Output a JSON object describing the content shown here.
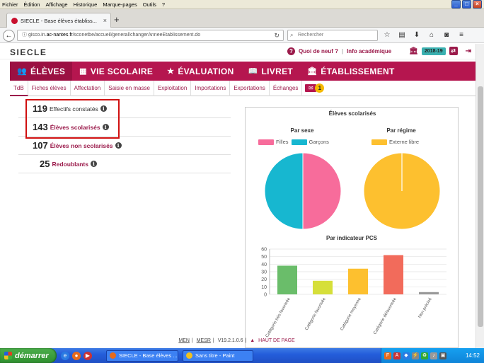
{
  "browser": {
    "menu": [
      "Fichier",
      "Édition",
      "Affichage",
      "Historique",
      "Marque-pages",
      "Outils",
      "?"
    ],
    "tab_title": "SIECLE - Base élèves établiss...",
    "url_prefix": "gisco.in.",
    "url_domain": "ac-nantes.fr",
    "url_path": "/sconetbe/accueil/general/changerAnneeEtablissement.do",
    "search_placeholder": "Rechercher"
  },
  "header": {
    "logo": "SIECLE",
    "whats_new": "Quoi de neuf ?",
    "academic_info": "Info académique",
    "year": "2018-19"
  },
  "main_nav": [
    {
      "label": "ÉLÈVES",
      "icon": "users-icon",
      "active": true
    },
    {
      "label": "VIE SCOLAIRE",
      "icon": "calendar-icon",
      "active": false
    },
    {
      "label": "ÉVALUATION",
      "icon": "star-icon",
      "active": false
    },
    {
      "label": "LIVRET",
      "icon": "book-icon",
      "active": false
    },
    {
      "label": "ÉTABLISSEMENT",
      "icon": "building-icon",
      "active": false
    }
  ],
  "sub_nav": [
    {
      "label": "TdB",
      "active": true
    },
    {
      "label": "Fiches élèves"
    },
    {
      "label": "Affectation"
    },
    {
      "label": "Saisie en masse"
    },
    {
      "label": "Exploitation"
    },
    {
      "label": "Importations"
    },
    {
      "label": "Exportations"
    },
    {
      "label": "Échanges"
    }
  ],
  "mail_count": "1",
  "stats": [
    {
      "value": "119",
      "label": "Effectifs constatés",
      "link": false
    },
    {
      "value": "143",
      "label": "Élèves scolarisés",
      "link": true
    },
    {
      "value": "107",
      "label": "Élèves non scolarisés",
      "link": true
    },
    {
      "value": "25",
      "label": "Redoublants",
      "link": true
    }
  ],
  "panel_title": "Élèves scolarisés",
  "chart_data": [
    {
      "type": "pie",
      "title": "Par sexe",
      "categories": [
        "Filles",
        "Garçons"
      ],
      "values": [
        50,
        50
      ],
      "colors": [
        "#f76c9b",
        "#17b7d0"
      ],
      "legend": "top"
    },
    {
      "type": "pie",
      "title": "Par régime",
      "categories": [
        "Externe libre"
      ],
      "values": [
        100
      ],
      "colors": [
        "#fdc02f"
      ],
      "legend": "top"
    },
    {
      "type": "bar",
      "title": "Par indicateur PCS",
      "categories": [
        "Catégorie très favorisée",
        "Catégorie favorisée",
        "Catégorie moyenne",
        "Catégorie défavorisée",
        "Non précisé"
      ],
      "values": [
        38,
        18,
        34,
        52,
        3
      ],
      "colors": [
        "#6abd6a",
        "#d6df3a",
        "#fdc02f",
        "#f26b5b",
        "#999999"
      ],
      "ylim": [
        0,
        60
      ],
      "yticks": [
        0,
        10,
        20,
        30,
        40,
        50,
        60
      ],
      "grid": true
    }
  ],
  "footer": {
    "men": "MEN",
    "mesr": "MESR",
    "version": "V19.2.1.0.6",
    "top_link": "HAUT DE PAGE"
  },
  "taskbar": {
    "start": "démarrer",
    "item1": "SIECLE - Base élèves ...",
    "item2": "Sans titre - Paint",
    "clock": "14:52"
  }
}
